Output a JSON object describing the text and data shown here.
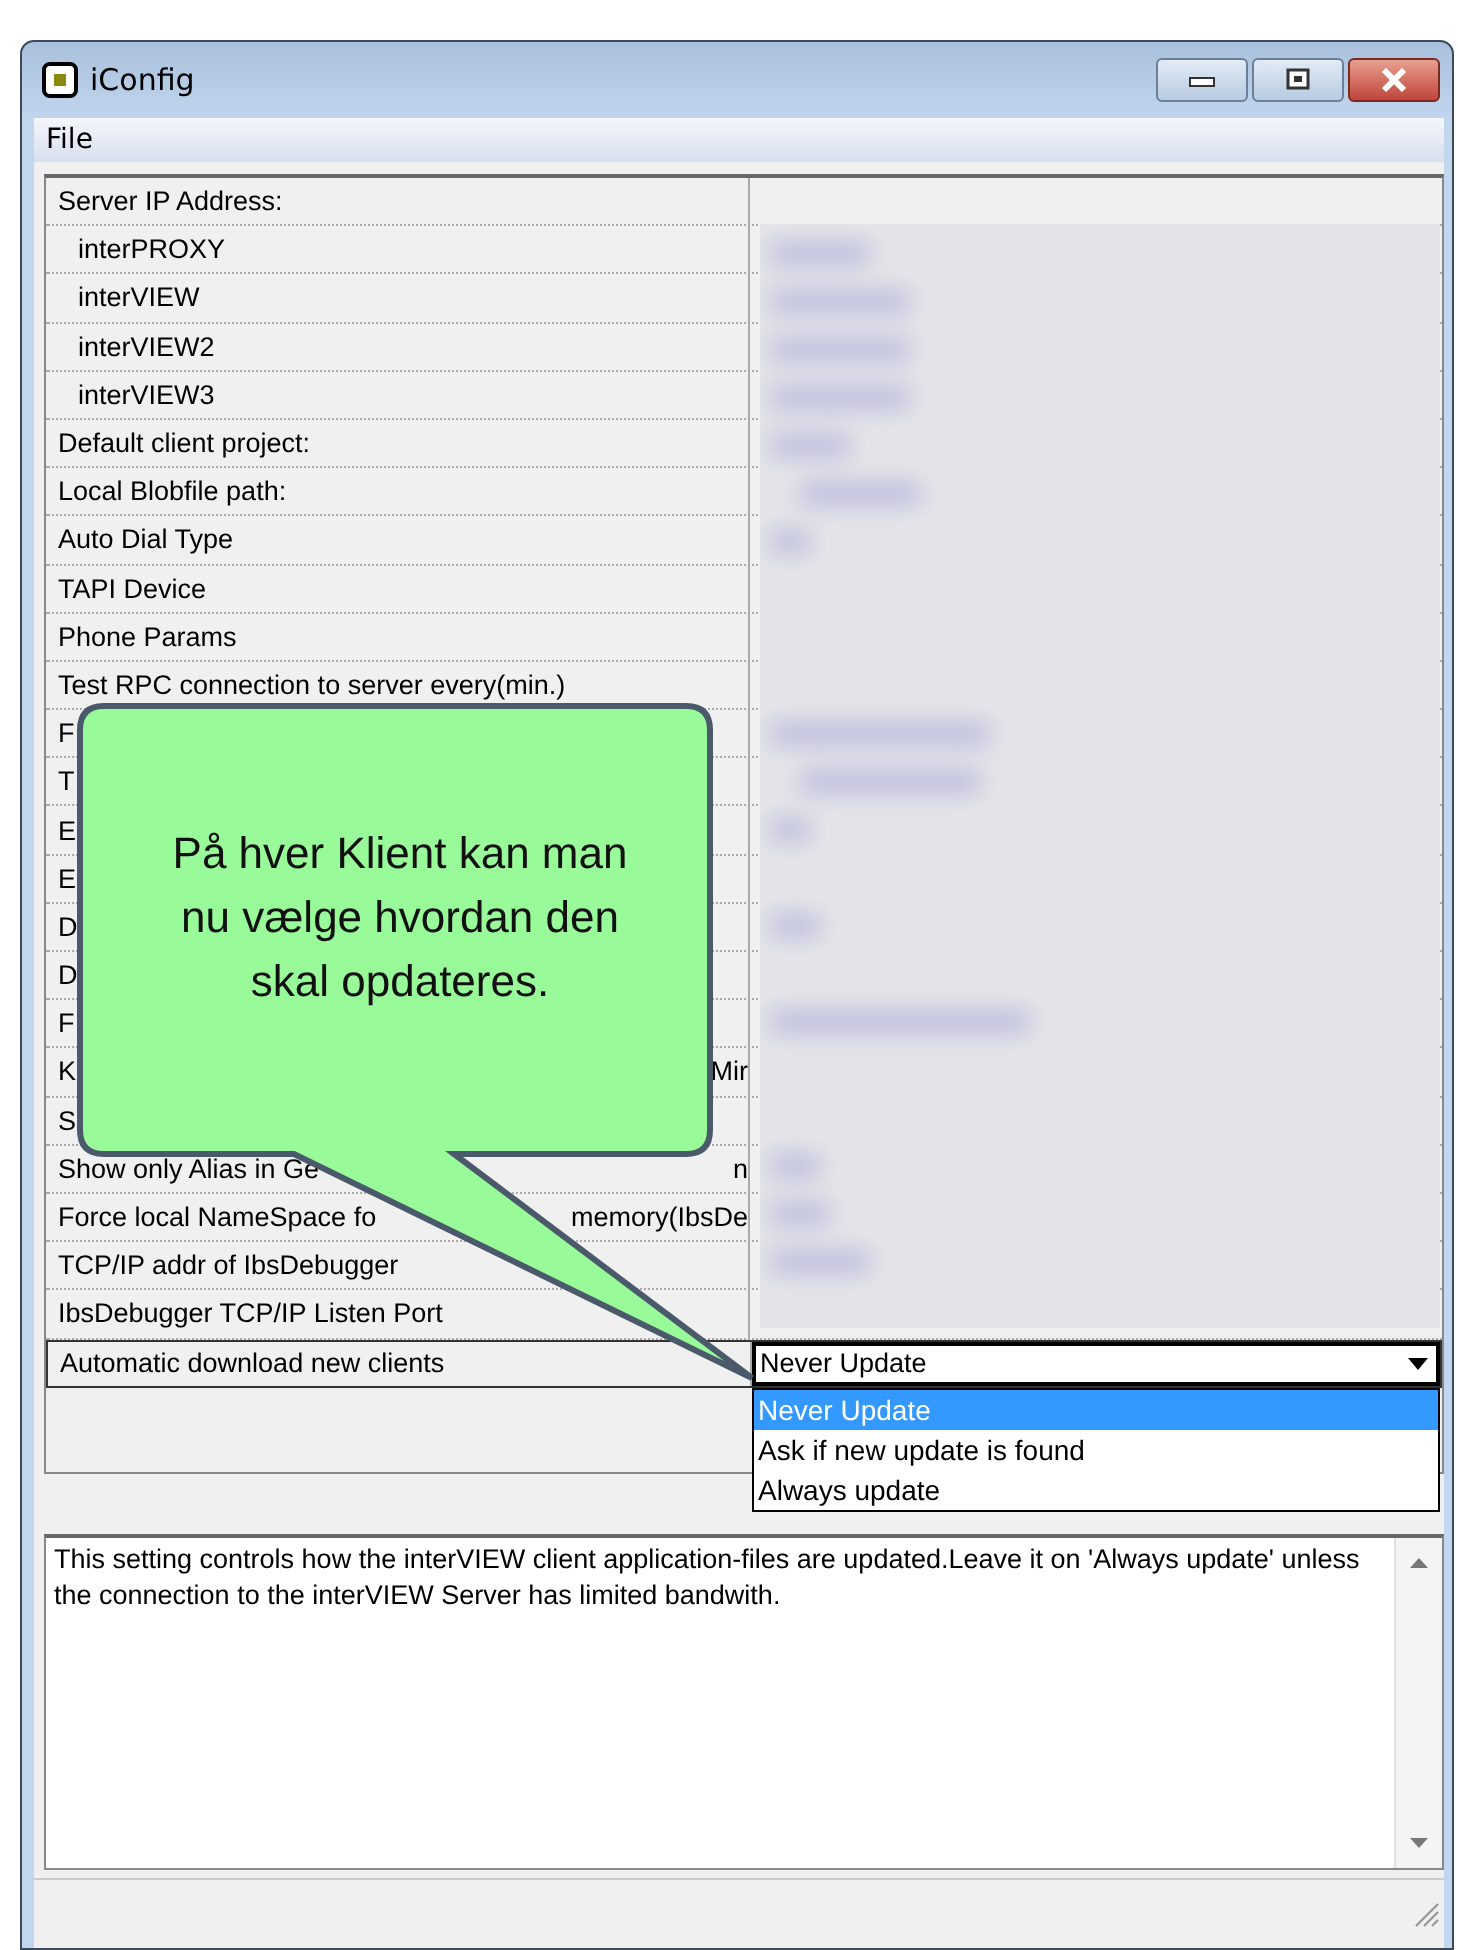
{
  "window": {
    "title": "iConfig"
  },
  "menu": [
    {
      "label": "File"
    }
  ],
  "rows": [
    {
      "label": "Server IP Address:",
      "children": [
        {
          "label": "interPROXY"
        },
        {
          "label": "interVIEW"
        },
        {
          "label": "interVIEW2"
        },
        {
          "label": "interVIEW3"
        }
      ]
    },
    {
      "label": "Default client project:"
    },
    {
      "label": "Local Blobfile path:"
    },
    {
      "label": "Auto Dial Type"
    },
    {
      "label": "TAPI Device"
    },
    {
      "label": "Phone Params"
    },
    {
      "label": "Test RPC connection to server every(min.)"
    },
    {
      "label": "F"
    },
    {
      "label": "T"
    },
    {
      "label": "E"
    },
    {
      "label": "E"
    },
    {
      "label": "D"
    },
    {
      "label": "D"
    },
    {
      "label": "F"
    },
    {
      "label": "K",
      "label_tail": "Mir"
    },
    {
      "label": "S"
    },
    {
      "label": "Show only Alias in Ge",
      "label_tail": "n"
    },
    {
      "label": "Force local NameSpace fo",
      "label_tail": "memory(IbsDe"
    },
    {
      "label": "TCP/IP addr of IbsDebugger"
    },
    {
      "label": "IbsDebugger TCP/IP Listen Port"
    },
    {
      "label": "Automatic download new clients",
      "kind": "dropdown",
      "value": "Never Update",
      "expanded": true,
      "options": [
        {
          "label": "Never Update",
          "selected": true
        },
        {
          "label": "Ask if new update is found",
          "selected": false
        },
        {
          "label": "Always update",
          "selected": false
        }
      ]
    }
  ],
  "callout": {
    "text": "På hver Klient kan man nu vælge hvordan den skal opdateres."
  },
  "description": "This setting controls how the interVIEW client application-files are updated.Leave it on 'Always update' unless the connection to the interVIEW Server has limited bandwith."
}
